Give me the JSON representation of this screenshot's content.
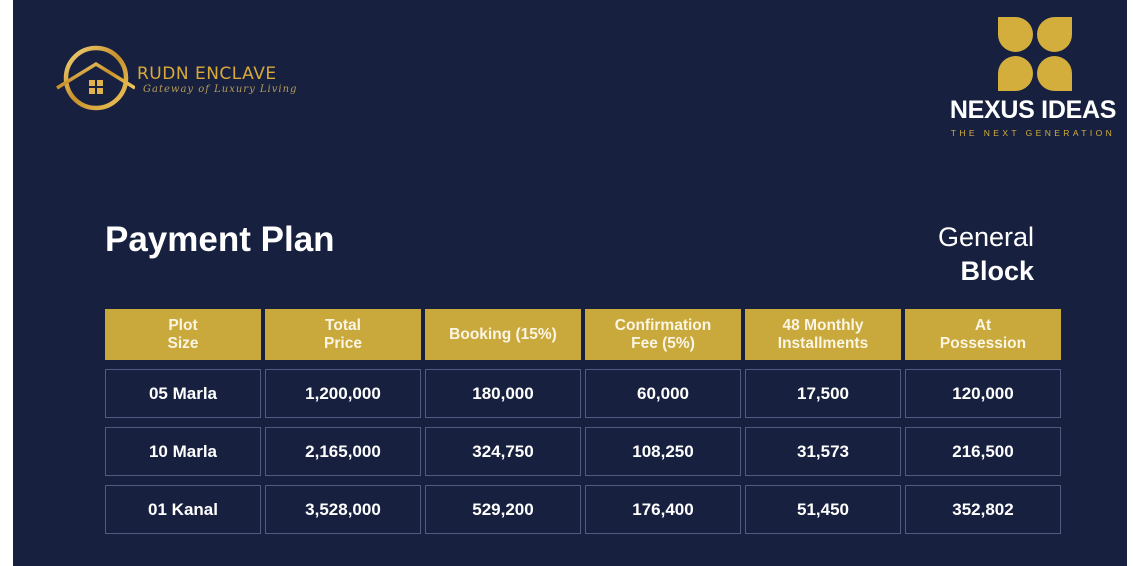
{
  "brand_left": {
    "name": "RUDN ENCLAVE",
    "tagline": "Gateway of Luxury Living",
    "icon": "house-in-circle-icon"
  },
  "brand_right": {
    "name": "NEXUS IDEAS",
    "tagline": "THE NEXT GENERATION",
    "icon": "four-petal-icon"
  },
  "title": "Payment Plan",
  "block": {
    "line1": "General",
    "line2": "Block"
  },
  "colors": {
    "background": "#17213f",
    "accent_gold": "#c9a83c",
    "text": "#ffffff",
    "cell_border": "#4f5b80"
  },
  "table": {
    "headers": [
      "Plot\nSize",
      "Total\nPrice",
      "Booking (15%)",
      "Confirmation\nFee (5%)",
      "48 Monthly\nInstallments",
      "At\nPossession"
    ],
    "rows": [
      [
        "05 Marla",
        "1,200,000",
        "180,000",
        "60,000",
        "17,500",
        "120,000"
      ],
      [
        "10 Marla",
        "2,165,000",
        "324,750",
        "108,250",
        "31,573",
        "216,500"
      ],
      [
        "01 Kanal",
        "3,528,000",
        "529,200",
        "176,400",
        "51,450",
        "352,802"
      ]
    ]
  }
}
